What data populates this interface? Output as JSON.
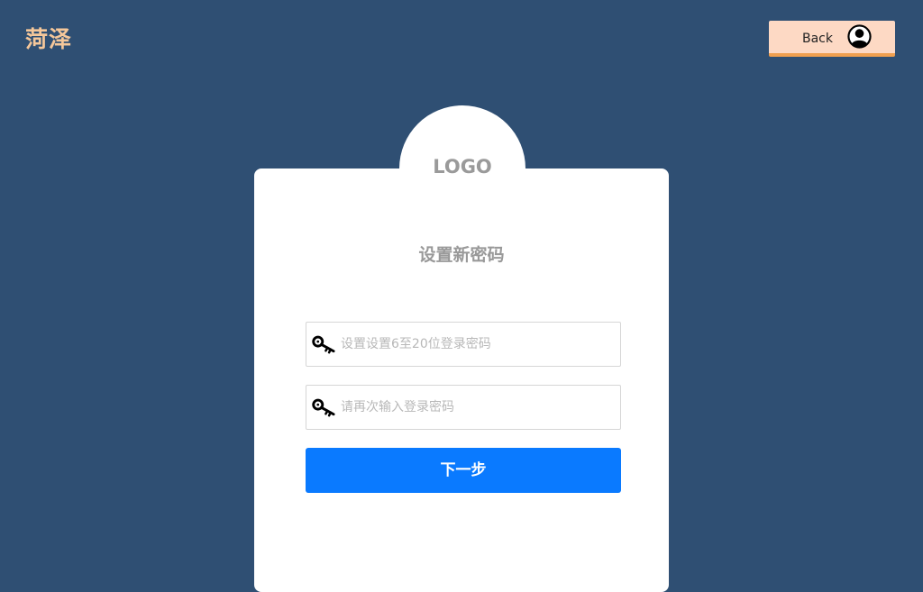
{
  "header": {
    "brand": "菏泽",
    "back_label": "Back",
    "back_icon": "user-circle-icon"
  },
  "card": {
    "logo_text": "LOGO",
    "title": "设置新密码",
    "fields": [
      {
        "icon": "key-icon",
        "value": "",
        "placeholder": "设置设置6至20位登录密码"
      },
      {
        "icon": "key-icon",
        "value": "",
        "placeholder": "请再次输入登录密码"
      }
    ],
    "submit_label": "下一步"
  },
  "colors": {
    "background": "#2f4f73",
    "brand": "#f5c79a",
    "back_button": "#fdd9c4",
    "back_button_accent": "#f0a050",
    "primary": "#0a7aff",
    "card": "#ffffff",
    "muted_text": "#999999"
  }
}
